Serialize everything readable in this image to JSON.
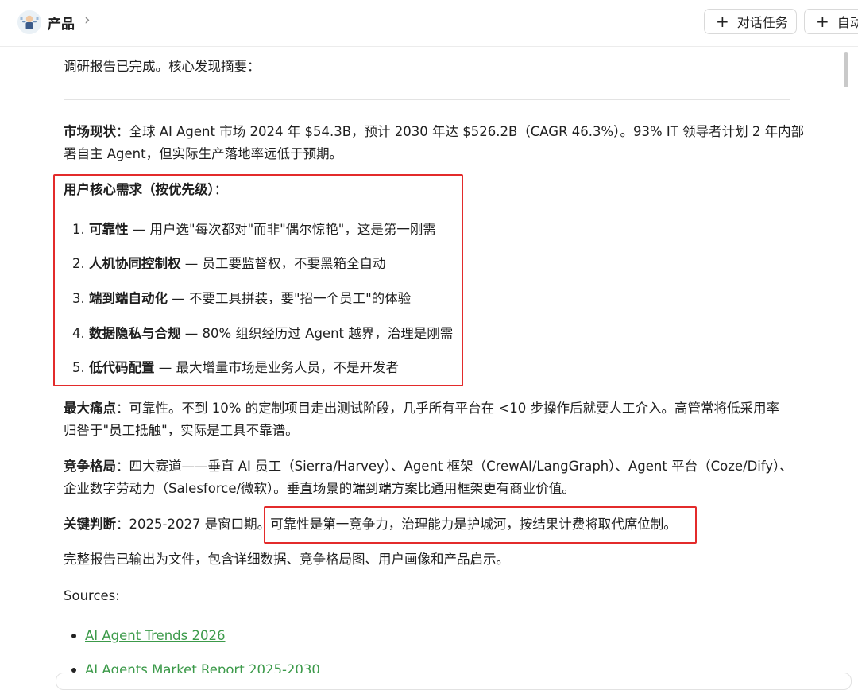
{
  "header": {
    "breadcrumb": "产品",
    "chevron_icon": "chevron-right",
    "buttons": [
      {
        "icon": "plus",
        "label": "对话任务"
      },
      {
        "icon": "plus",
        "label": "自动"
      }
    ]
  },
  "report": {
    "intro": "调研报告已完成。核心发现摘要：",
    "market_label": "市场现状",
    "market_text_1": "：全球 AI Agent 市场 2024 年 $54.3B，预计 2030 年达 $526.2B（CAGR 46.3%）。93% IT 领导者计划 2 年内部",
    "market_text_2": "署自主 Agent，但实际生产落地率远低于预期。",
    "needs_title": "用户核心需求（按优先级）",
    "needs_colon": "：",
    "needs": [
      {
        "num": "1.",
        "bold": "可靠性",
        "text": " — 用户选\"每次都对\"而非\"偶尔惊艳\"，这是第一刚需"
      },
      {
        "num": "2.",
        "bold": "人机协同控制权",
        "text": " — 员工要监督权，不要黑箱全自动"
      },
      {
        "num": "3.",
        "bold": "端到端自动化",
        "text": " — 不要工具拼装，要\"招一个员工\"的体验"
      },
      {
        "num": "4.",
        "bold": "数据隐私与合规",
        "text": " — 80% 组织经历过 Agent 越界，治理是刚需"
      },
      {
        "num": "5.",
        "bold": "低代码配置",
        "text": " — 最大增量市场是业务人员，不是开发者"
      }
    ],
    "pain_label": "最大痛点",
    "pain_text_1": "：可靠性。不到 10% 的定制项目走出测试阶段，几乎所有平台在 <10 步操作后就要人工介入。高管常将低采用率",
    "pain_text_2": "归咎于\"员工抵触\"，实际是工具不靠谱。",
    "comp_label": "竞争格局",
    "comp_text_1": "：四大赛道——垂直 AI 员工（Sierra/Harvey）、Agent 框架（CrewAI/LangGraph）、Agent 平台（Coze/Dify）、",
    "comp_text_2": "企业数字劳动力（Salesforce/微软）。垂直场景的端到端方案比通用框架更有商业价值。",
    "judge_label": "关键判断",
    "judge_text_a": "：2025-2027 是窗口期。",
    "judge_text_b": "可靠性是第一竞争力，治理能力是护城河，按结果计费将取代席位制。",
    "full_report": "完整报告已输出为文件，包含详细数据、竞争格局图、用户画像和产品启示。",
    "sources_label": "Sources:",
    "sources": [
      "AI Agent Trends 2026",
      "AI Agents Market Report 2025-2030"
    ]
  },
  "colors": {
    "highlight_box": "#e32b2b",
    "link": "#3c9a4a"
  }
}
